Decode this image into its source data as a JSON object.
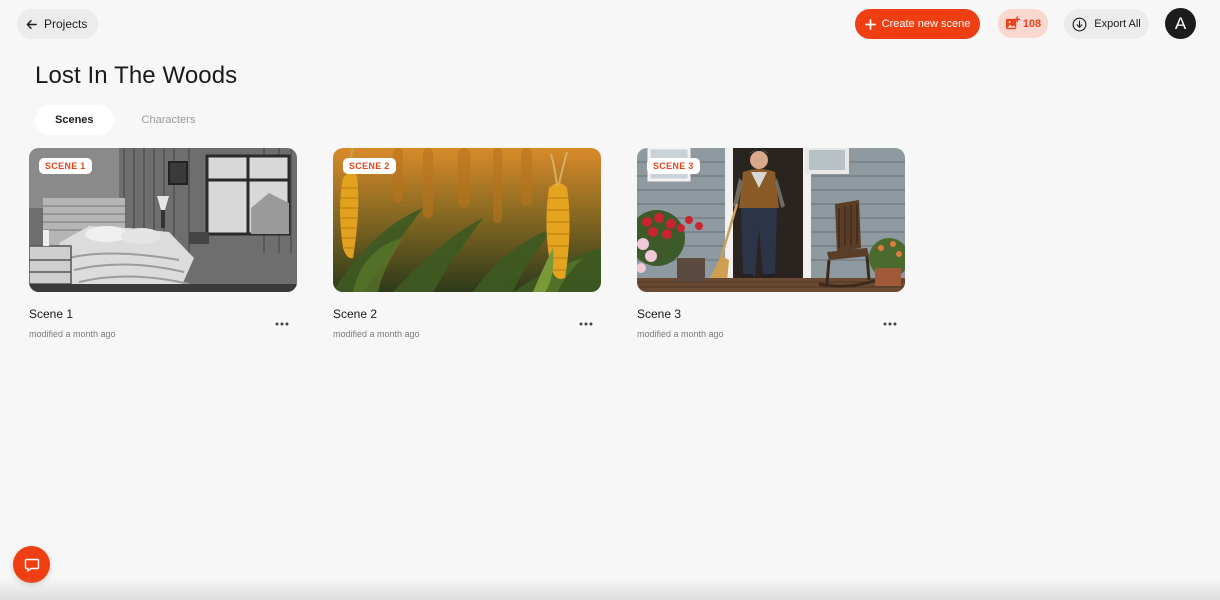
{
  "header": {
    "back_label": "Projects",
    "create_label": "Create new scene",
    "credits": "108",
    "export_label": "Export All",
    "avatar_initial": "A"
  },
  "project": {
    "title": "Lost In The Woods"
  },
  "tabs": [
    {
      "label": "Scenes",
      "active": true
    },
    {
      "label": "Characters",
      "active": false
    }
  ],
  "scenes": [
    {
      "badge": "SCENE 1",
      "title": "Scene 1",
      "modified": "modified a month ago",
      "image": "black-and-white bedroom"
    },
    {
      "badge": "SCENE 2",
      "title": "Scene 2",
      "modified": "modified a month ago",
      "image": "corn field at sunset"
    },
    {
      "badge": "SCENE 3",
      "title": "Scene 3",
      "modified": "modified a month ago",
      "image": "old man with broom on porch"
    }
  ],
  "colors": {
    "accent": "#ef3e12",
    "credits_bg": "#fbd8cf",
    "background": "#f7f7f7"
  },
  "icons": [
    "arrow-left-icon",
    "plus-icon",
    "image-plus-icon",
    "download-circle-icon",
    "more-dots-icon",
    "chat-bubble-icon"
  ]
}
